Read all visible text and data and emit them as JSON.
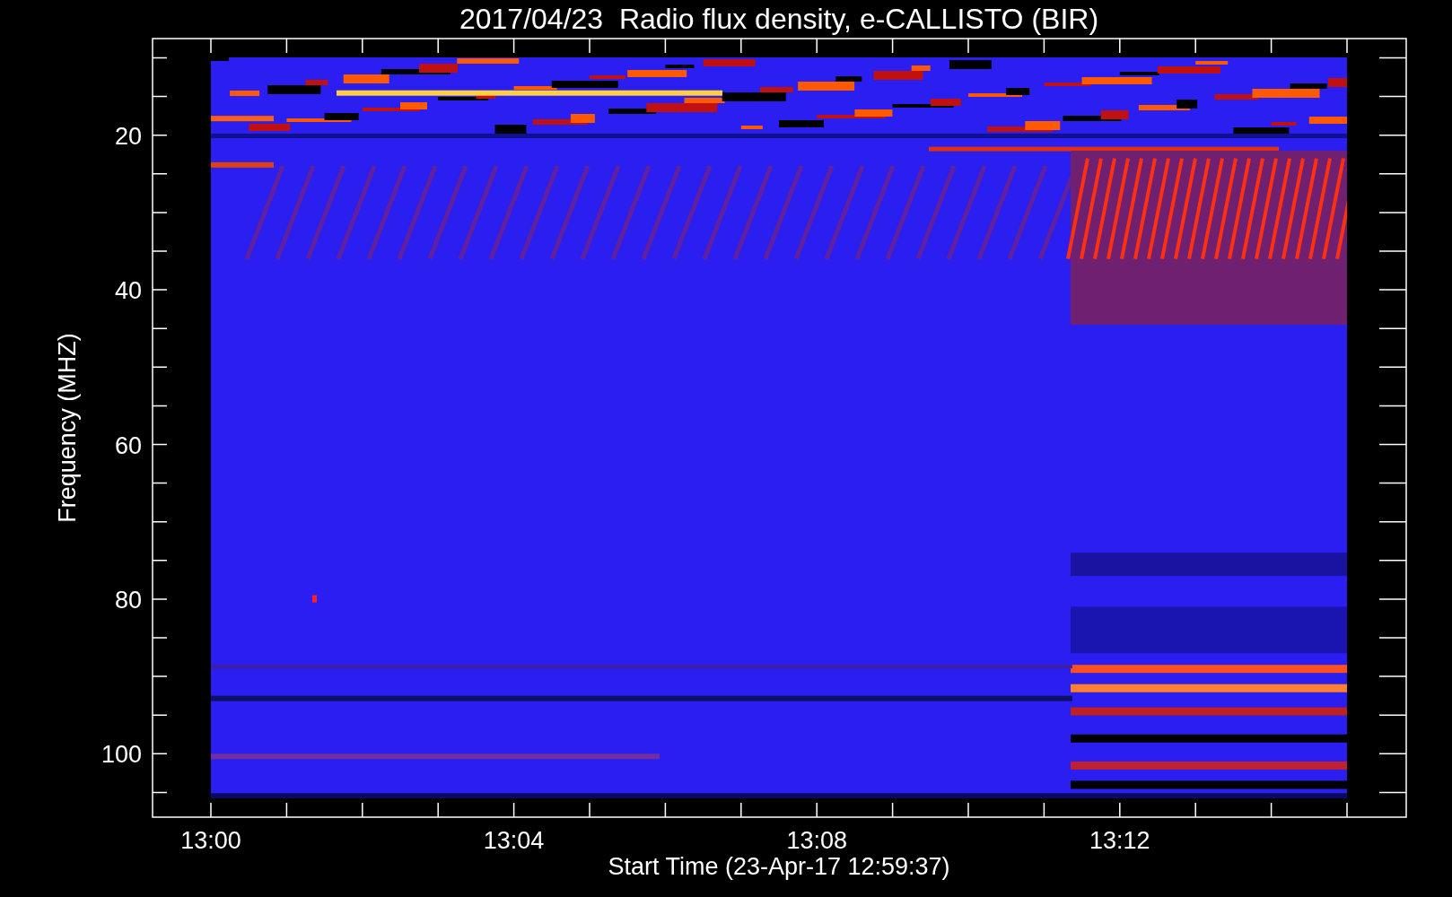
{
  "title": "2017/04/23  Radio flux density, e-CALLISTO (BIR)",
  "y_axis": {
    "label": "Frequency (MHZ)",
    "ticks": [
      "20",
      "40",
      "60",
      "80",
      "100"
    ]
  },
  "x_axis": {
    "label": "Start Time (23-Apr-17 12:59:37)",
    "ticks": [
      "13:00",
      "13:04",
      "13:08",
      "13:12"
    ]
  }
}
